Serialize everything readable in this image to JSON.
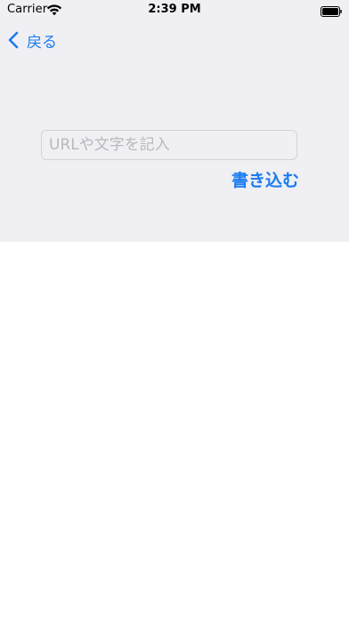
{
  "status_bar": {
    "carrier": "Carrier",
    "time": "2:39 PM",
    "wifi_icon": "wifi-icon",
    "battery_icon": "battery-icon"
  },
  "nav": {
    "back_label": "戻る",
    "back_icon": "chevron-left-icon"
  },
  "form": {
    "input_value": "",
    "input_placeholder": "URLや文字を記入",
    "write_button_label": "書き込む"
  },
  "colors": {
    "accent": "#1a7cf0",
    "panel_background": "#efeff4",
    "page_background": "#ffffff"
  }
}
